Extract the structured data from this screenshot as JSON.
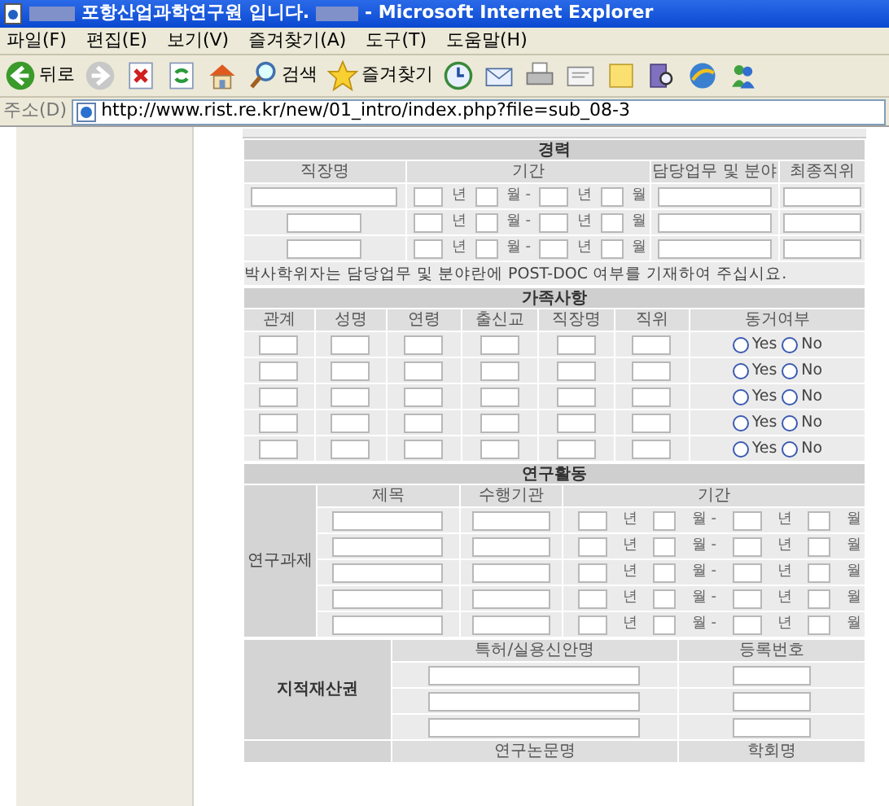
{
  "window": {
    "title": "포항산업과학연구원 입니다.",
    "app": "- Microsoft Internet Explorer"
  },
  "menu": [
    "파일(F)",
    "편집(E)",
    "보기(V)",
    "즐겨찾기(A)",
    "도구(T)",
    "도움말(H)"
  ],
  "toolbar": [
    {
      "kind": "back",
      "label": "뒤로"
    },
    {
      "kind": "forward"
    },
    {
      "kind": "stop"
    },
    {
      "kind": "refresh"
    },
    {
      "kind": "home"
    },
    {
      "kind": "search",
      "label": "검색"
    },
    {
      "kind": "favorites",
      "label": "즐겨찾기"
    },
    {
      "kind": "history"
    },
    {
      "kind": "mail"
    },
    {
      "kind": "print"
    },
    {
      "kind": "edit"
    },
    {
      "kind": "note"
    },
    {
      "kind": "research"
    },
    {
      "kind": "globe"
    },
    {
      "kind": "messenger"
    }
  ],
  "address": {
    "label": "주소(D)",
    "url": "http://www.rist.re.kr/new/01_intro/index.php?file=sub_08-3"
  },
  "career": {
    "title": "경력",
    "columns": [
      "직장명",
      "기간",
      "담당업무 및 분야",
      "최종직위"
    ],
    "rows": [
      {
        "period": [
          "년",
          "월 -",
          "년",
          "월"
        ]
      },
      {
        "period": [
          "년",
          "월 -",
          "년",
          "월"
        ]
      },
      {
        "period": [
          "년",
          "월 -",
          "년",
          "월"
        ]
      }
    ],
    "note": "박사학위자는 담당업무 및 분야란에 POST-DOC 여부를 기재하여 주십시요."
  },
  "family": {
    "title": "가족사항",
    "columns": [
      "관계",
      "성명",
      "연령",
      "출신교",
      "직장명",
      "직위",
      "동거여부"
    ],
    "rows": [
      {
        "options": [
          {
            "label": "Yes",
            "selected": false
          },
          {
            "label": "No",
            "selected": false
          }
        ]
      },
      {
        "options": [
          {
            "label": "Yes",
            "selected": false
          },
          {
            "label": "No",
            "selected": false
          }
        ]
      },
      {
        "options": [
          {
            "label": "Yes",
            "selected": false
          },
          {
            "label": "No",
            "selected": false
          }
        ]
      },
      {
        "options": [
          {
            "label": "Yes",
            "selected": false
          },
          {
            "label": "No",
            "selected": false
          }
        ]
      },
      {
        "options": [
          {
            "label": "Yes",
            "selected": false
          },
          {
            "label": "No",
            "selected": false
          }
        ]
      }
    ]
  },
  "research": {
    "title": "연구활동",
    "label": "연구과제",
    "columns": [
      "제목",
      "수행기관",
      "기간"
    ],
    "rows": [
      {
        "period": [
          "년",
          "월 -",
          "년",
          "월"
        ]
      },
      {
        "period": [
          "년",
          "월 -",
          "년",
          "월"
        ]
      },
      {
        "period": [
          "년",
          "월 -",
          "년",
          "월"
        ]
      },
      {
        "period": [
          "년",
          "월 -",
          "년",
          "월"
        ]
      },
      {
        "period": [
          "년",
          "월 -",
          "년",
          "월"
        ]
      }
    ]
  },
  "ip": {
    "label": "지적재산권",
    "columns": [
      "특허/실용신안명",
      "등록번호"
    ]
  },
  "papers": {
    "columns": [
      "연구논문명",
      "학회명"
    ]
  }
}
